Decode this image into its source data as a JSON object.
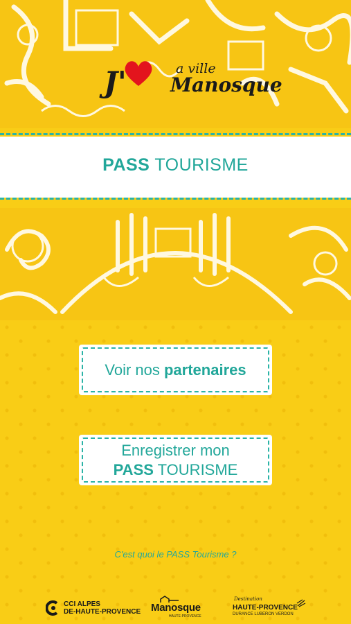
{
  "logo": {
    "j": "J'",
    "a_ville": "a ville",
    "manosque": "Manosque"
  },
  "band": {
    "title_bold": "PASS",
    "title_rest": " TOURISME"
  },
  "buttons": {
    "partners_prefix": "Voir nos ",
    "partners_bold": "partenaires",
    "register_line1": "Enregistrer mon",
    "register_bold": "PASS",
    "register_rest": " TOURISME"
  },
  "info_link": "C'est quoi le PASS Tourisme ?",
  "footer": {
    "cci_line1": "CCI ALPES",
    "cci_line2": "DE-HAUTE-PROVENCE",
    "manosque": "Manosque",
    "manosque_sub": "HAUTE-PROVENCE",
    "hp_destination": "Destination",
    "hp_main": "HAUTE-PROVENCE",
    "hp_sub": "DURANCE LUBERON VERDON"
  },
  "colors": {
    "background": "#f9cd16",
    "accent": "#22a79a",
    "heart": "#e3141d"
  }
}
